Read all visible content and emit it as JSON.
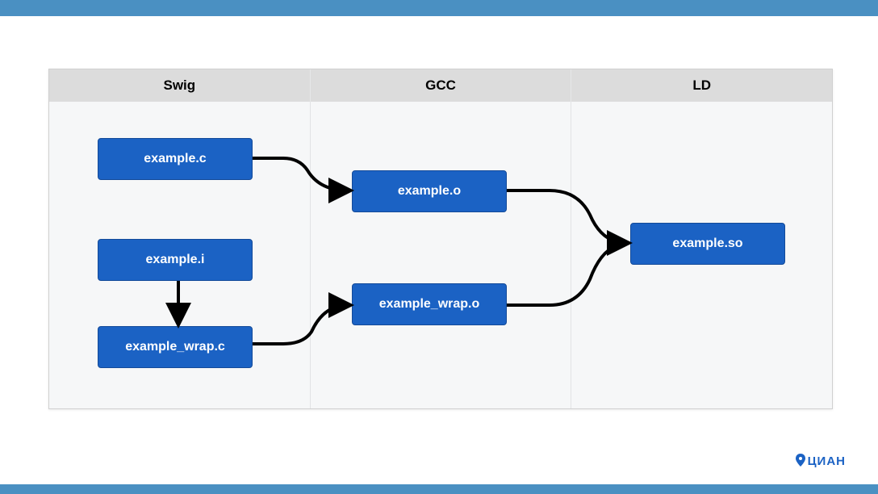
{
  "columns": [
    "Swig",
    "GCC",
    "LD"
  ],
  "nodes": {
    "example_c": "example.c",
    "example_i": "example.i",
    "example_wrap_c": "example_wrap.c",
    "example_o": "example.o",
    "example_wrap_o": "example_wrap.o",
    "example_so": "example.so"
  },
  "logo": "ЦИАН",
  "colors": {
    "node": "#1b62c4",
    "bar": "#4a90c2"
  }
}
